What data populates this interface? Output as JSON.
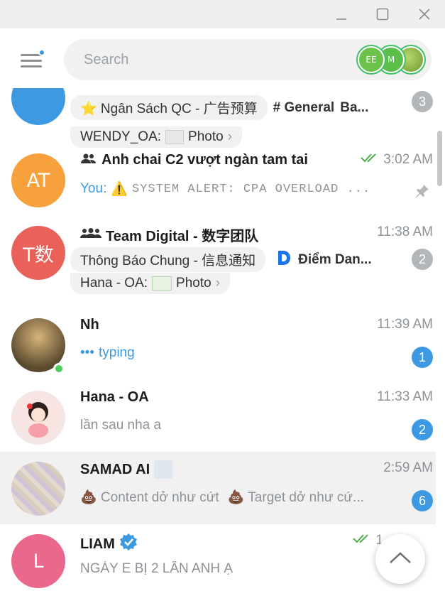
{
  "search": {
    "placeholder": "Search"
  },
  "stories": [
    {
      "label": "EE",
      "color": "#6cc24a"
    },
    {
      "label": "M",
      "color": "#5bbf4a"
    },
    {
      "label": "",
      "color": "#8ab84a"
    }
  ],
  "chats": [
    {
      "name": "Ngân Sách QC - 广告预算",
      "topic_pill": "⭐ Ngân Sách QC - 广告预算",
      "topic_2": "# General",
      "topic_3": "Ba...",
      "preview_sender": "WENDY_OA:",
      "preview_text": "Photo",
      "badge": "3",
      "avatar_color": "#3d9ae2"
    },
    {
      "name": "Anh chai C2 vượt ngàn tam tai",
      "time": "3:02 AM",
      "preview_sender": "You:",
      "preview_emoji": "⚠️",
      "preview_text": "SYSTEM ALERT: CPA OVERLOAD ...",
      "avatar_text": "AT",
      "avatar_color": "#f7a13c"
    },
    {
      "name": "Team Digital - 数字团队",
      "time": "11:38 AM",
      "topic_1": "Thông Báo Chung - 信息通知",
      "topic_2": "Điểm Dan...",
      "preview_sender": "Hana - OA:",
      "preview_text": "Photo",
      "badge": "2",
      "avatar_text": "T数",
      "avatar_color": "#ea6159"
    },
    {
      "name": "Nh",
      "time": "11:39 AM",
      "preview_text": "typing",
      "badge": "1",
      "avatar_color": "#6b5a3a"
    },
    {
      "name": "Hana - OA",
      "time": "11:33 AM",
      "preview_text": "lần sau nha a",
      "badge": "2",
      "avatar_color": "#f4e6e6"
    },
    {
      "name": "SAMAD AI",
      "time": "2:59 AM",
      "preview_text_1": "💩 Content dở như cứt",
      "preview_text_2": "💩 Target dở như cứ...",
      "badge": "6",
      "avatar_color": "#d8d0c8"
    },
    {
      "name": "LIAM",
      "time": "1",
      "preview_text": "NGÀY E BỊ 2 LẦN ANH Ạ",
      "avatar_text": "L",
      "avatar_color": "#e9688c"
    }
  ]
}
